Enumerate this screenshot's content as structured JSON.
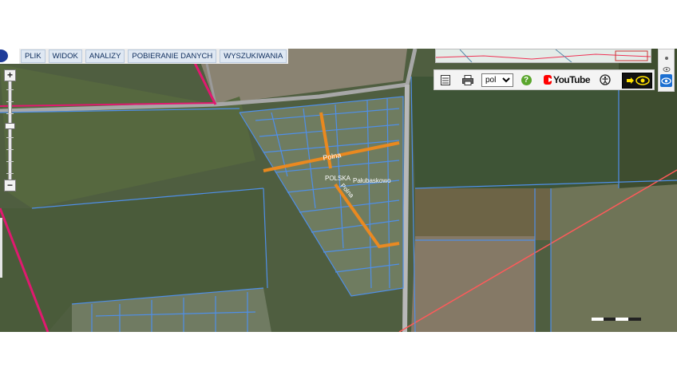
{
  "menu": {
    "items": [
      {
        "label": "PLIK"
      },
      {
        "label": "WIDOK"
      },
      {
        "label": "ANALIZY"
      },
      {
        "label": "POBIERANIE DANYCH"
      },
      {
        "label": "WYSZUKIWANIA"
      }
    ]
  },
  "zoom": {
    "plus_label": "+",
    "minus_label": "−"
  },
  "toolbar": {
    "language": {
      "value": "pol",
      "options": [
        "pol"
      ]
    },
    "help_label": "?",
    "youtube_label": "YouTube",
    "icons": [
      "legend-icon",
      "print-icon",
      "help-icon",
      "youtube-logo",
      "accessibility-icon",
      "high-contrast-icon"
    ]
  },
  "map": {
    "street_labels": [
      "Polna",
      "POLSKA",
      "Polna",
      "Pałubaskowo"
    ]
  },
  "colors": {
    "parcel_lines": "#4f8fe8",
    "boundary": "#e0196f",
    "highlight_road": "#f08a1c",
    "powerline": "#ff5a5a"
  }
}
